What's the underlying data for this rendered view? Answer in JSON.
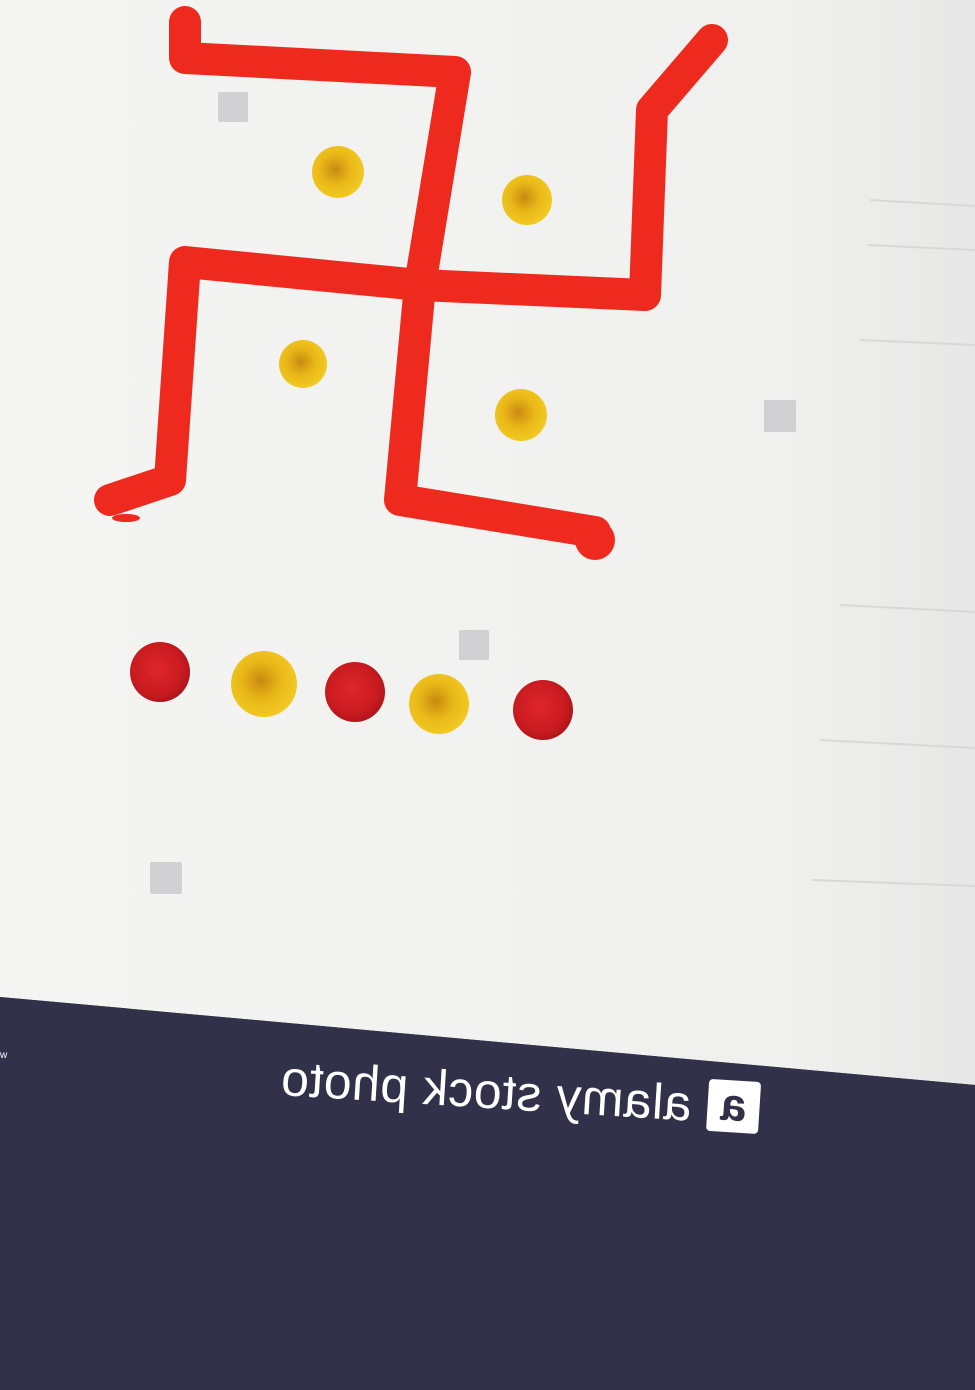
{
  "watermark": {
    "brand_text": "alamy stock photo",
    "logo_letter": "a",
    "edge_mark": "w",
    "bar_color": "#31324a"
  },
  "photo": {
    "paper_color": "#f2f2f0",
    "symbol_color": "#ee2a1e",
    "dot_colors": [
      "#d01f22",
      "#e7b315",
      "#d01f22",
      "#e7b315",
      "#d01f22"
    ],
    "yellow_color": "#e7b315"
  }
}
